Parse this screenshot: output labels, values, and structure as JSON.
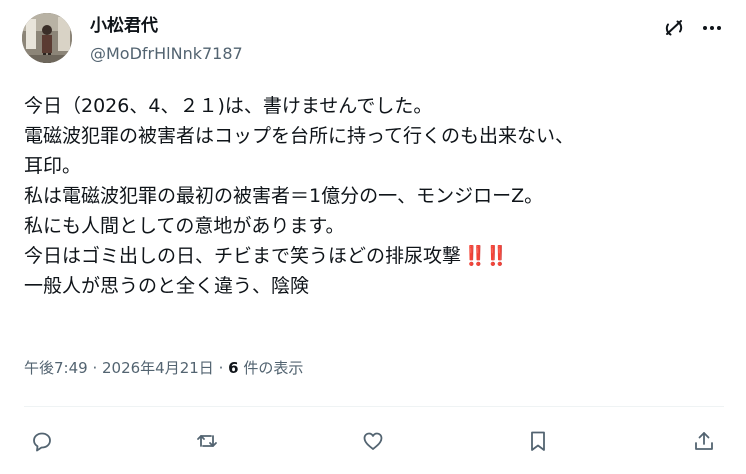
{
  "user": {
    "display_name": "小松君代",
    "handle": "@MoDfrHlNnk7187"
  },
  "post": {
    "lines": [
      "今日（2026、4、２１)は、書けませんでした。",
      "電磁波犯罪の被害者はコップを台所に持って行くのも出来ない、",
      "耳印。",
      "私は電磁波犯罪の最初の被害者＝1億分の一、モンジローZ。",
      "私にも人間としての意地があります。",
      "今日はゴミ出しの日、チビまで笑うほどの排尿攻撃",
      "一般人が思うのと全く違う、陰険"
    ],
    "emphasis": "‼️‼️"
  },
  "meta": {
    "time": "午後7:49",
    "separator": " · ",
    "date": "2026年4月21日",
    "views_count": "6",
    "views_label": " 件の表示"
  },
  "icons": {
    "grok": "grok-icon",
    "more": "more-icon",
    "reply": "reply-icon",
    "repost": "repost-icon",
    "like": "heart-icon",
    "bookmark": "bookmark-icon",
    "share": "share-icon"
  },
  "colors": {
    "text": "#0f1419",
    "secondary": "#536471",
    "divider": "#eff3f4",
    "emphasis": "#c8102e"
  }
}
